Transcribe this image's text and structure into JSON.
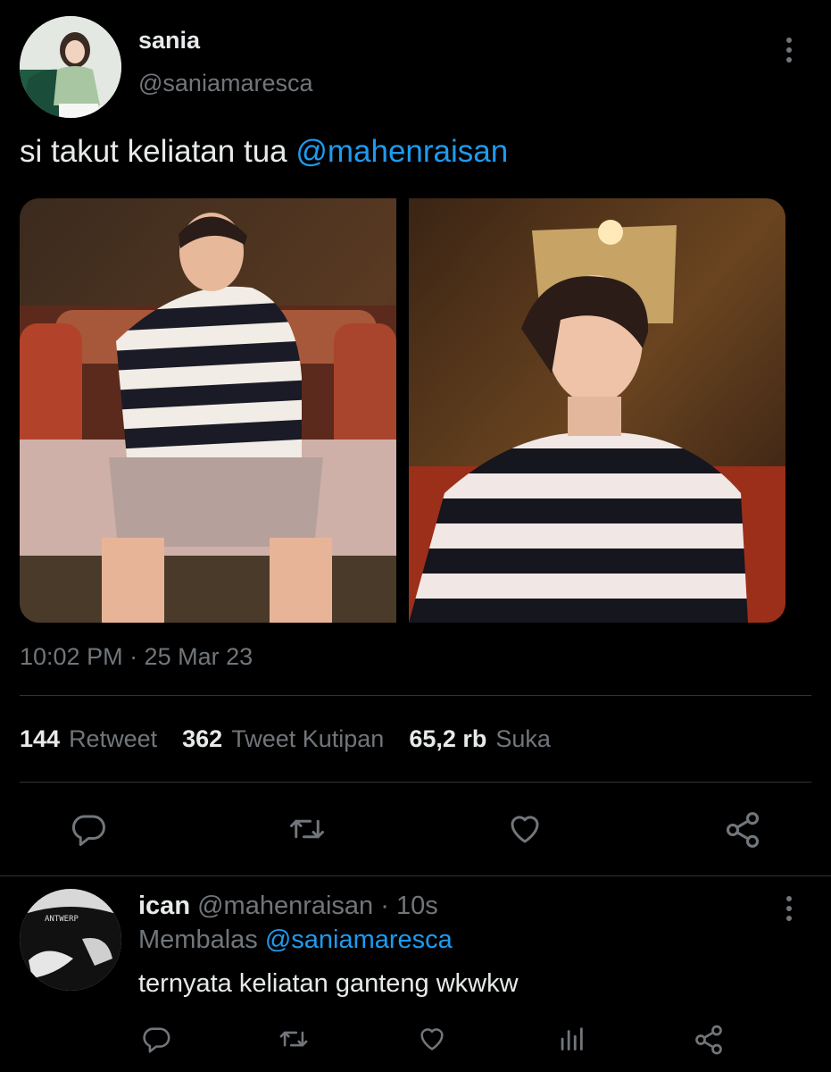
{
  "tweet": {
    "author": {
      "name": "sania",
      "handle": "@saniamaresca"
    },
    "text_prefix": "si takut keliatan tua ",
    "mention": "@mahenraisan",
    "timestamp": "10:02 PM · 25 Mar 23",
    "stats": [
      {
        "count": "144",
        "label": "Retweet"
      },
      {
        "count": "362",
        "label": "Tweet Kutipan"
      },
      {
        "count": "65,2 rb",
        "label": "Suka"
      }
    ],
    "actions": [
      "reply-icon",
      "retweet-icon",
      "like-icon",
      "share-icon"
    ]
  },
  "reply": {
    "author": {
      "name": "ican",
      "handle": "@mahenraisan"
    },
    "dot": " · ",
    "time": "10s",
    "replying_prefix": "Membalas ",
    "replying_to": "@saniamaresca",
    "text": "ternyata keliatan ganteng wkwkw",
    "shirt_text": "ANTWERP",
    "actions": [
      "reply-icon",
      "retweet-icon",
      "like-icon",
      "analytics-icon",
      "share-icon"
    ]
  },
  "colors": {
    "background": "#000000",
    "text": "#e7e9ea",
    "muted": "#71767b",
    "link": "#1d9bf0",
    "divider": "#2f3336"
  }
}
